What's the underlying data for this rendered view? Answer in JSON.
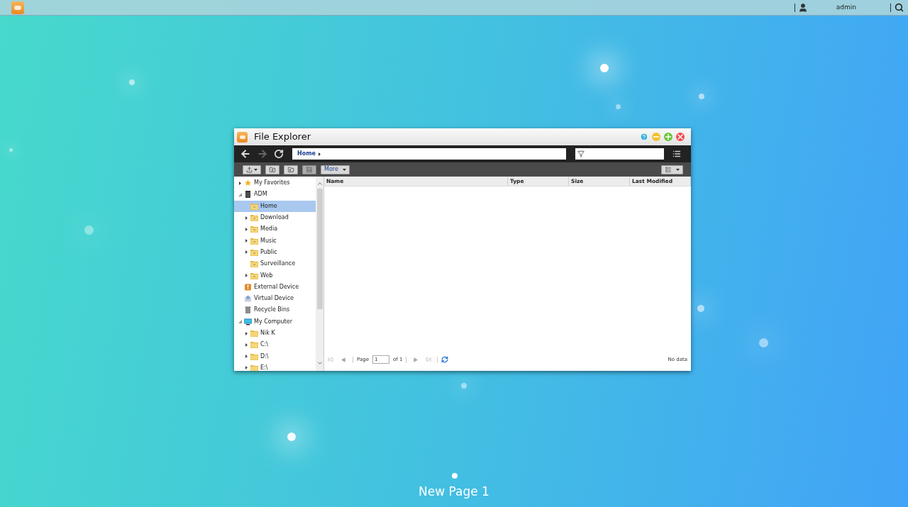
{
  "top_bar": {
    "user": "admin"
  },
  "window": {
    "title": "File Explorer"
  },
  "nav": {
    "path": "Home"
  },
  "toolbar": {
    "more": "More"
  },
  "tree": [
    {
      "label": "My Favorites",
      "kind": "star",
      "expanded": false,
      "selected": false
    },
    {
      "label": "ADM",
      "kind": "nas",
      "expanded": true,
      "selected": false,
      "children": [
        {
          "label": "Home",
          "kind": "share",
          "selected": true
        },
        {
          "label": "Download",
          "kind": "share",
          "expanded": false,
          "selected": false
        },
        {
          "label": "Media",
          "kind": "share",
          "expanded": false,
          "selected": false
        },
        {
          "label": "Music",
          "kind": "share",
          "expanded": false,
          "selected": false
        },
        {
          "label": "Public",
          "kind": "share",
          "expanded": false,
          "selected": false
        },
        {
          "label": "Surveillance",
          "kind": "share",
          "selected": false
        },
        {
          "label": "Web",
          "kind": "share",
          "expanded": false,
          "selected": false
        }
      ]
    },
    {
      "label": "External Device",
      "kind": "usb",
      "selected": false
    },
    {
      "label": "Virtual Device",
      "kind": "virtual",
      "selected": false
    },
    {
      "label": "Recycle Bins",
      "kind": "trash",
      "selected": false
    },
    {
      "label": "My Computer",
      "kind": "computer",
      "expanded": true,
      "selected": false,
      "children": [
        {
          "label": "Nik K",
          "kind": "folder",
          "expanded": false,
          "selected": false
        },
        {
          "label": "C:\\",
          "kind": "folder",
          "expanded": false,
          "selected": false
        },
        {
          "label": "D:\\",
          "kind": "folder",
          "expanded": false,
          "selected": false
        },
        {
          "label": "E:\\",
          "kind": "folder",
          "expanded": false,
          "selected": false
        }
      ]
    }
  ],
  "table": {
    "columns": [
      "Name",
      "Type",
      "Size",
      "Last Modified"
    ]
  },
  "pager": {
    "page_label": "Page",
    "page_value": "1",
    "of": "of 1",
    "status": "No data"
  },
  "desktop": {
    "page_name": "New Page 1"
  }
}
